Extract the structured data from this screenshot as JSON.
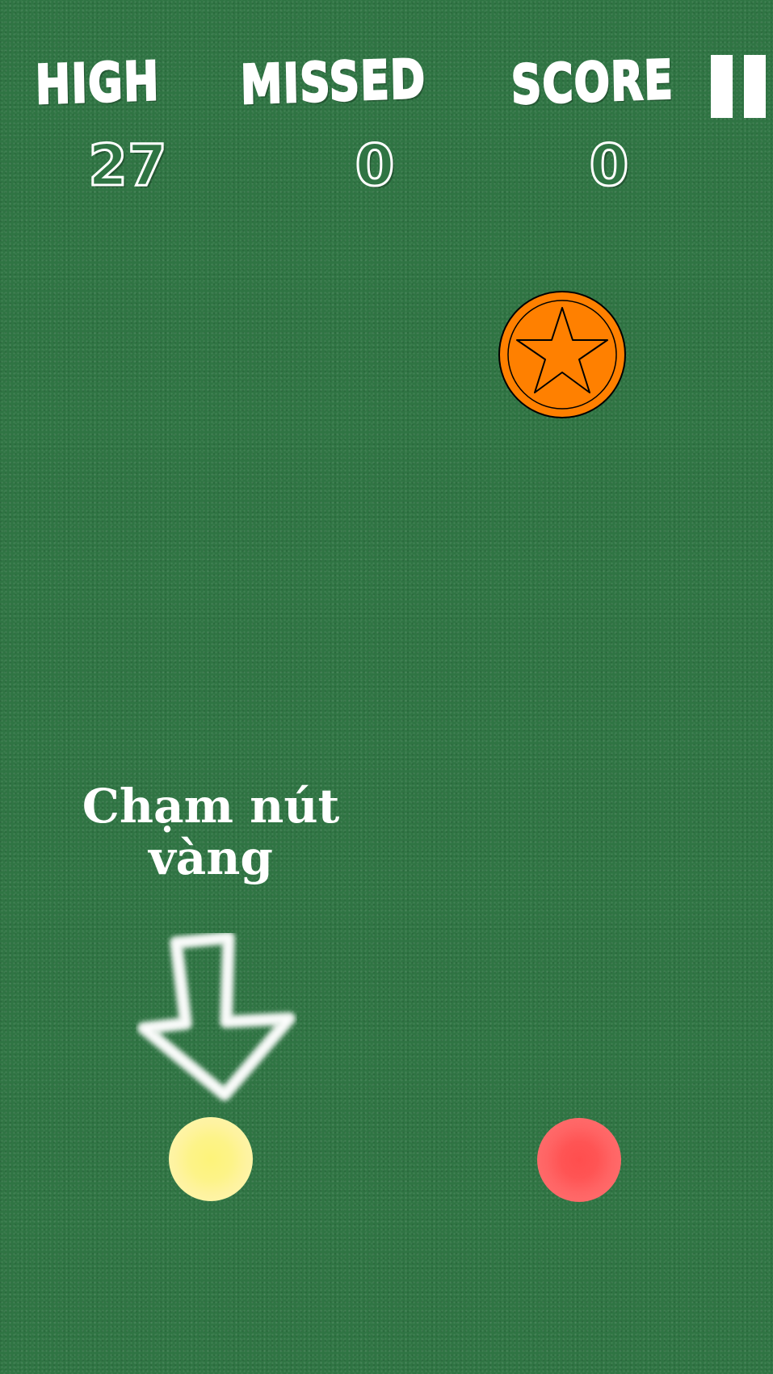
{
  "hud": {
    "labels": {
      "high": "HIGH",
      "missed": "MISSED",
      "score": "SCORE"
    },
    "values": {
      "high": "27",
      "missed": "0",
      "score": "0"
    }
  },
  "pause": {
    "icon": "pause-icon"
  },
  "falling_item": {
    "icon": "star-coin-icon",
    "color": "#ff8000"
  },
  "hint": {
    "line1": "Chạm nút",
    "line2": "vàng",
    "icon": "down-arrow-icon"
  },
  "buttons": {
    "left": {
      "color": "#fdf388",
      "icon": "yellow-circle"
    },
    "right": {
      "color": "#ff5a5a",
      "icon": "red-circle"
    }
  },
  "colors": {
    "background": "#2f7443",
    "text": "#ffffff"
  }
}
